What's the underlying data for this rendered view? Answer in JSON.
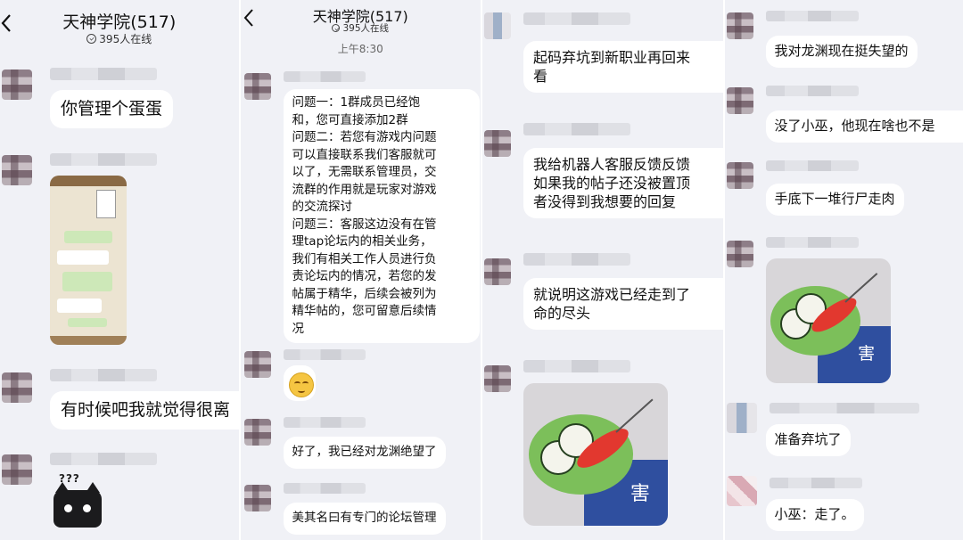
{
  "panel1": {
    "title": "天神学院(517)",
    "online": "395人在线",
    "messages": [
      "你管理个蛋蛋",
      "有时候吧我就觉得很离"
    ]
  },
  "panel2": {
    "title": "天神学院(517)",
    "online": "395人在线",
    "time": "上午8:30",
    "long_message": "问题一：1群成员已经饱\n和，您可直接添加2群\n问题二：若您有游戏内问题\n可以直接联系我们客服就可\n以了，无需联系管理员，交\n流群的作用就是玩家对游戏\n的交流探讨\n问题三：客服这边没有在管\n理tap论坛内的相关业务，\n我们有相关工作人员进行负\n责论坛内的情况，若您的发\n帖属于精华，后续会被列为\n精华帖的，您可留意后续情\n况",
    "messages": [
      "好了，我已经对龙渊绝望了",
      "美其名曰有专门的论坛管理"
    ]
  },
  "panel3": {
    "messages": [
      "起码弃坑到新职业再回来\n看",
      "我给机器人客服反馈反馈\n如果我的帖子还没被置顶\n者没得到我想要的回复",
      "就说明这游戏已经走到了\n命的尽头"
    ],
    "sticker_text": "害"
  },
  "panel4": {
    "messages": [
      "我对龙渊现在挺失望的",
      "没了小巫，他现在啥也不是",
      "手底下一堆行尸走肉",
      "准备弃坑了",
      "小巫：走了。"
    ],
    "sticker_text": "害"
  },
  "meme_text": "???",
  "colors": {
    "background": "#f0f1f6",
    "bubble": "#ffffff",
    "frog_green": "#7cbf5a",
    "blanket_blue": "#2f4f9f"
  }
}
